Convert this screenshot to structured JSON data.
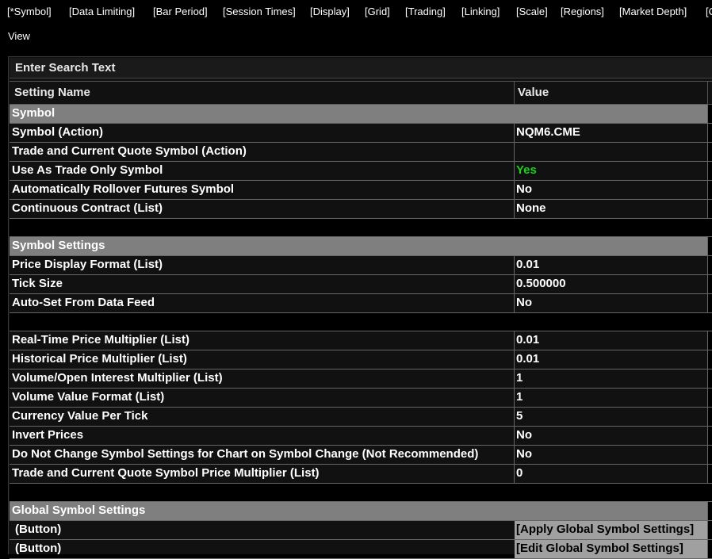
{
  "tabs": [
    "[*Symbol]",
    "[Data Limiting]",
    "[Bar Period]",
    "[Session Times]",
    "[Display]",
    "[Grid]",
    "[Trading]",
    "[Linking]",
    "[Scale]",
    "[Regions]",
    "[Market Depth]",
    "[C"
  ],
  "view_label": "View",
  "search": {
    "placeholder": "Enter Search Text"
  },
  "columns": {
    "name": "Setting Name",
    "value": "Value"
  },
  "rows": [
    {
      "type": "group",
      "name": "Symbol"
    },
    {
      "type": "item",
      "name": "Symbol (Action)",
      "value": "NQM6.CME"
    },
    {
      "type": "item",
      "name": "Trade and Current Quote Symbol (Action)",
      "value": ""
    },
    {
      "type": "item",
      "name": "Use As Trade Only Symbol",
      "value": "Yes"
    },
    {
      "type": "item",
      "name": "Automatically Rollover Futures Symbol",
      "value": "No"
    },
    {
      "type": "item",
      "name": "Continuous Contract (List)",
      "value": "None"
    },
    {
      "type": "gap"
    },
    {
      "type": "group",
      "name": "Symbol Settings"
    },
    {
      "type": "item",
      "name": "Price Display Format (List)",
      "value": "0.01"
    },
    {
      "type": "item",
      "name": "Tick Size",
      "value": "0.500000"
    },
    {
      "type": "item",
      "name": "Auto-Set From Data Feed",
      "value": "No"
    },
    {
      "type": "gap"
    },
    {
      "type": "item",
      "name": "Real-Time Price Multiplier (List)",
      "value": "0.01"
    },
    {
      "type": "item",
      "name": "Historical Price Multiplier (List)",
      "value": "0.01"
    },
    {
      "type": "item",
      "name": "Volume/Open Interest Multiplier (List)",
      "value": "1"
    },
    {
      "type": "item",
      "name": "Volume Value Format (List)",
      "value": "1"
    },
    {
      "type": "item",
      "name": "Currency Value Per Tick",
      "value": "5"
    },
    {
      "type": "item",
      "name": "Invert Prices",
      "value": "No"
    },
    {
      "type": "item",
      "name": "Do Not Change Symbol Settings for Chart on Symbol Change (Not Recommended)",
      "value": "No"
    },
    {
      "type": "item",
      "name": "Trade and Current Quote Symbol Price Multiplier (List)",
      "value": "0"
    },
    {
      "type": "gap"
    },
    {
      "type": "group",
      "name": "Global Symbol Settings"
    },
    {
      "type": "button",
      "name": "(Button)",
      "value": "[Apply Global Symbol Settings]"
    },
    {
      "type": "button",
      "name": "(Button)",
      "value": "[Edit Global Symbol Settings]"
    }
  ],
  "colors": {
    "yes_green": "#1bd21b",
    "group_bg": "#7f7f7f",
    "button_bg": "#a0a0a0"
  }
}
